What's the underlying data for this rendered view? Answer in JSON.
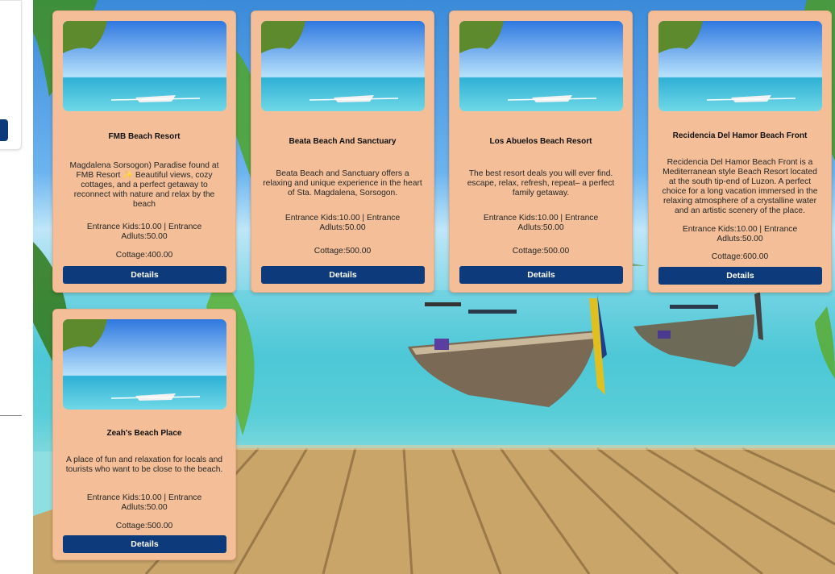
{
  "colors": {
    "card_bg": "#f4bf98",
    "button_bg": "#0d3a7a",
    "button_text": "#ffffff"
  },
  "background": {
    "icon": "tropical-beach-scene"
  },
  "resorts": [
    {
      "name": "FMB Beach Resort",
      "description": "Magdalena Sorsogon) Paradise found at FMB Resort ✨ Beautiful views, cozy cottages, and a perfect getaway to reconnect with nature and relax by the beach",
      "entrance": "Entrance Kids:10.00 | Entrance Adluts:50.00",
      "cottage": "Cottage:400.00",
      "button": "Details"
    },
    {
      "name": "Beata Beach And Sanctuary",
      "description": "Beata Beach and Sanctuary offers a relaxing and unique experience in the heart of Sta. Magdalena, Sorsogon.",
      "entrance": "Entrance Kids:10.00 | Entrance Adluts:50.00",
      "cottage": "Cottage:500.00",
      "button": "Details"
    },
    {
      "name": "Los Abuelos Beach Resort",
      "description": "The best resort deals you will ever find. escape, relax, refresh, repeat– a perfect family getaway.",
      "entrance": "Entrance Kids:10.00 | Entrance Adluts:50.00",
      "cottage": "Cottage:500.00",
      "button": "Details"
    },
    {
      "name": "Recidencia Del Hamor Beach Front",
      "description": "Recidencia Del Hamor Beach Front is a Mediterranean style Beach Resort located at the south tip-end of Luzon. A perfect choice for a long vacation immersed in the relaxing atmosphere of a crystalline water and an artistic scenery of the place.",
      "entrance": "Entrance Kids:10.00 | Entrance Adluts:50.00",
      "cottage": "Cottage:600.00",
      "button": "Details"
    },
    {
      "name": "Zeah's Beach Place",
      "description": "A place of fun and relaxation for locals and tourists who want to be close to the beach.",
      "entrance": "Entrance Kids:10.00 | Entrance Adluts:50.00",
      "cottage": "Cottage:500.00",
      "button": "Details"
    }
  ]
}
